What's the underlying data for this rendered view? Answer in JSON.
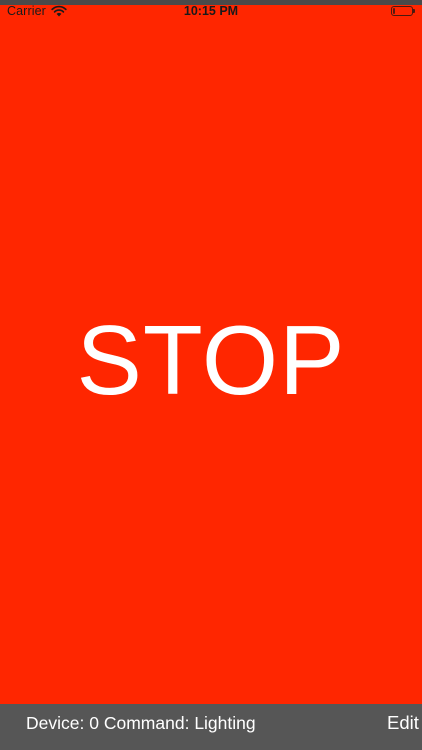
{
  "status_bar": {
    "carrier": "Carrier",
    "time": "10:15 PM",
    "battery_level": 0.1
  },
  "main": {
    "command": "STOP",
    "background_color": "#ff2600"
  },
  "toolbar": {
    "device_label": "Device:",
    "device_value": "0",
    "command_label": "Command:",
    "command_value": "Lighting",
    "edit_label": "Edit"
  }
}
